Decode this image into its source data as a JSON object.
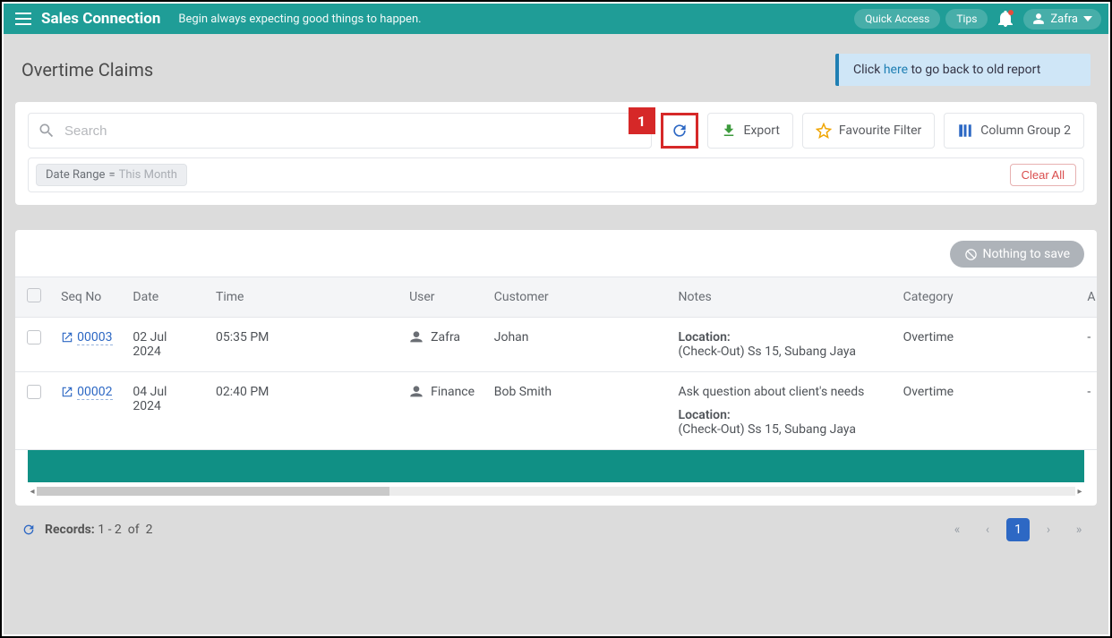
{
  "header": {
    "app_name": "Sales Connection",
    "motto": "Begin always expecting good things to happen.",
    "quick_access": "Quick Access",
    "tips": "Tips",
    "user_name": "Zafra"
  },
  "page": {
    "title": "Overtime Claims",
    "banner_prefix": "Click ",
    "banner_link": "here",
    "banner_suffix": " to go back to old report"
  },
  "toolbar": {
    "search_placeholder": "Search",
    "export_label": "Export",
    "favourite_label": "Favourite Filter",
    "column_group_label": "Column Group 2",
    "marker_number": "1"
  },
  "filters": {
    "date_range_label": "Date Range",
    "date_range_eq": "=",
    "date_range_value": "This Month",
    "clear_all": "Clear All"
  },
  "save_btn": "Nothing to save",
  "columns": {
    "seq": "Seq No",
    "date": "Date",
    "time": "Time",
    "user": "User",
    "customer": "Customer",
    "notes": "Notes",
    "category": "Category",
    "last": "A"
  },
  "rows": [
    {
      "seq": "00003",
      "date": "02 Jul 2024",
      "time": "05:35 PM",
      "user": "Zafra",
      "customer": "Johan",
      "notes_pre": "",
      "notes_loc_label": "Location:",
      "notes_loc": "(Check-Out) Ss 15, Subang Jaya",
      "category": "Overtime",
      "last": "-"
    },
    {
      "seq": "00002",
      "date": "04 Jul 2024",
      "time": "02:40 PM",
      "user": "Finance",
      "customer": "Bob Smith",
      "notes_pre": "Ask question about client's needs",
      "notes_loc_label": "Location:",
      "notes_loc": "(Check-Out) Ss 15, Subang Jaya",
      "category": "Overtime",
      "last": "-"
    }
  ],
  "footer": {
    "records_label": "Records:",
    "records_range": "1 - 2",
    "records_of": "of",
    "records_total": "2",
    "current_page": "1"
  }
}
